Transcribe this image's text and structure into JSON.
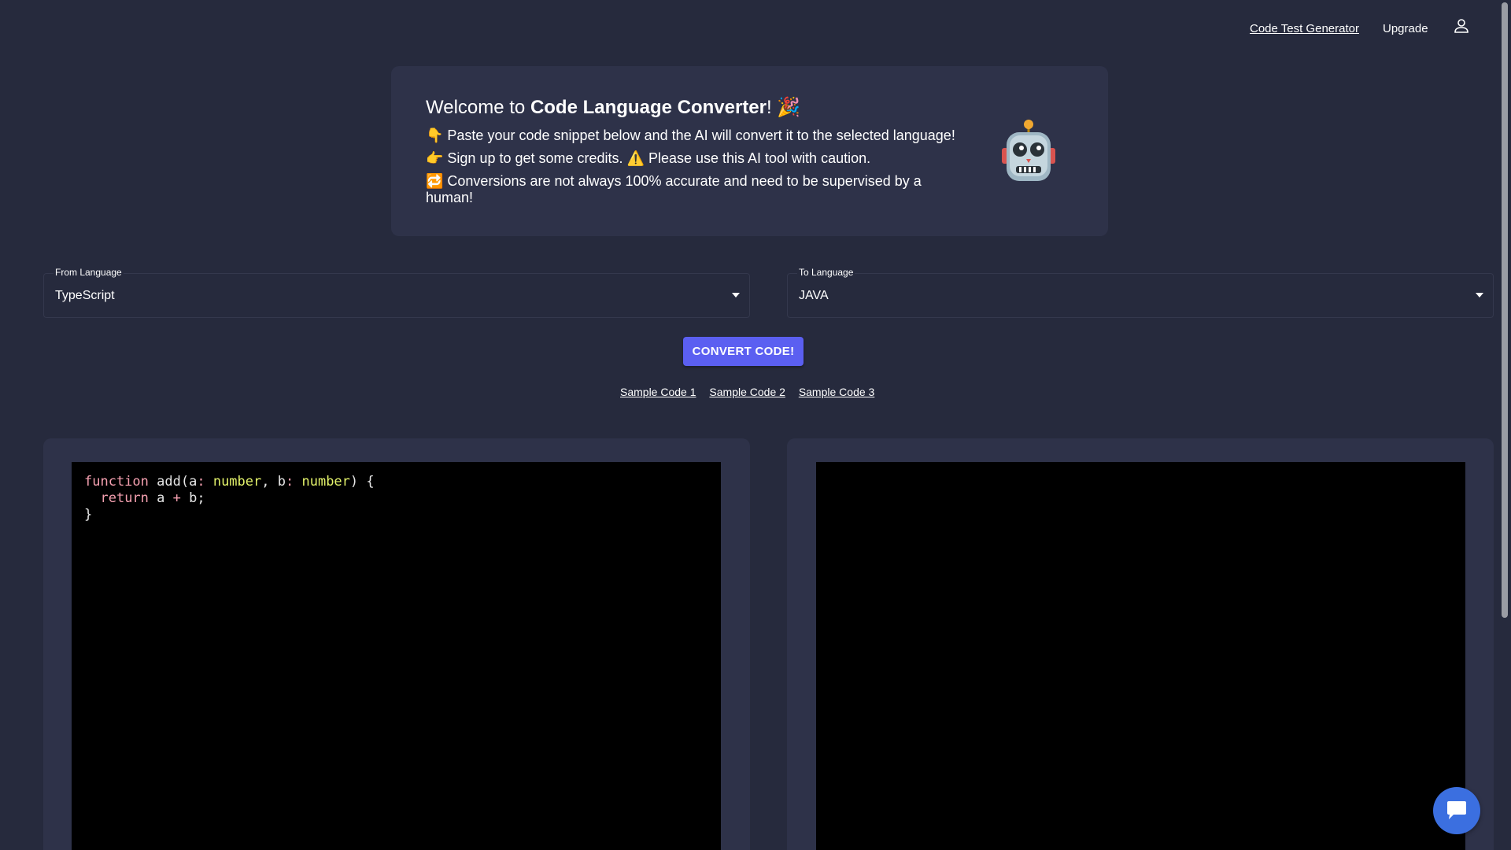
{
  "nav": {
    "code_test_generator": "Code Test Generator",
    "upgrade": "Upgrade",
    "user_icon": "user-icon"
  },
  "welcome": {
    "title_prefix": "Welcome to ",
    "title_bold": "Code Language Converter",
    "title_suffix": "! 🎉",
    "line1": "👇 Paste your code snippet below and the AI will convert it to the selected language!",
    "line2": "👉 Sign up to get some credits. ⚠️ Please use this AI tool with caution.",
    "line3": "🔁 Conversions are not always 100% accurate and need to be supervised by a human!",
    "robot_icon": "robot-icon"
  },
  "from_language": {
    "label": "From Language",
    "value": "TypeScript"
  },
  "to_language": {
    "label": "To Language",
    "value": "JAVA"
  },
  "convert_button": "CONVERT CODE!",
  "samples": [
    "Sample Code 1",
    "Sample Code 2",
    "Sample Code 3"
  ],
  "input_code": {
    "tokens": {
      "function": "function",
      "name": " add(",
      "a": "a",
      "colon": ":",
      "number": "number",
      "comma": ", ",
      "b": "b",
      "close": ") {",
      "ret_indent": "  ",
      "return": "return",
      "expr_a": " a ",
      "plus": "+",
      "expr_b": " b;",
      "brace": "}"
    }
  },
  "output_code": "",
  "colors": {
    "background": "#262a3d",
    "card": "#2e3249",
    "accent": "#5b5ff1",
    "chat": "#3b6fe0"
  },
  "chat_icon": "chat-icon"
}
